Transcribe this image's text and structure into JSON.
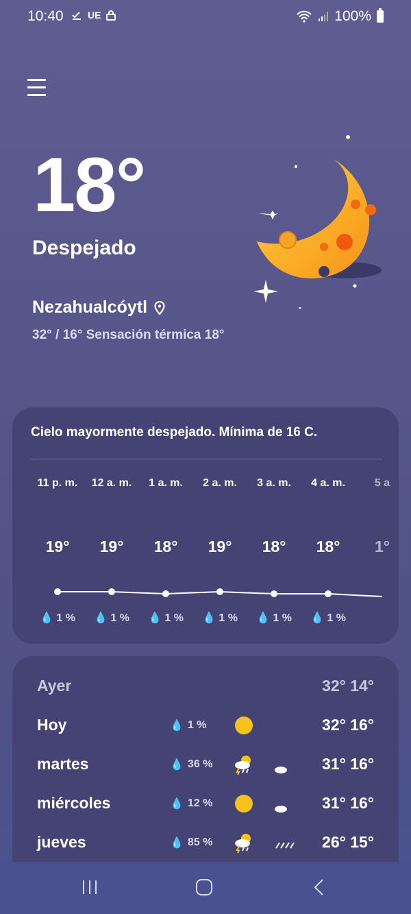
{
  "status_bar": {
    "time": "10:40",
    "notif_label": "UE",
    "battery": "100%"
  },
  "current": {
    "temperature": "18°",
    "condition": "Despejado",
    "location": "Nezahualcóytl",
    "range": "32° / 16° Sensación térmica 18°"
  },
  "hourly": {
    "summary": "Cielo mayormente despejado. Mínima de 16 C.",
    "items": [
      {
        "label": "11 p. m.",
        "temp": "19°",
        "precip": "1 %",
        "icon": "crescent-moon-icon"
      },
      {
        "label": "12 a. m.",
        "temp": "19°",
        "precip": "1 %",
        "icon": "crescent-moon-icon"
      },
      {
        "label": "1 a. m.",
        "temp": "18°",
        "precip": "1 %",
        "icon": "crescent-moon-icon"
      },
      {
        "label": "2 a. m.",
        "temp": "19°",
        "precip": "1 %",
        "icon": "crescent-moon-icon"
      },
      {
        "label": "3 a. m.",
        "temp": "18°",
        "precip": "1 %",
        "icon": "crescent-moon-icon"
      },
      {
        "label": "4 a. m.",
        "temp": "18°",
        "precip": "1 %",
        "icon": "crescent-moon-icon"
      },
      {
        "label": "5 a",
        "temp": "1°",
        "precip": "",
        "icon": "crescent-moon-icon"
      }
    ]
  },
  "daily": [
    {
      "day": "Ayer",
      "precip": "",
      "day_icon": "",
      "night_icon": "",
      "temps": "32° 14°"
    },
    {
      "day": "Hoy",
      "precip": "1 %",
      "day_icon": "sun-icon",
      "night_icon": "crescent-moon-icon",
      "temps": "32° 16°"
    },
    {
      "day": "martes",
      "precip": "36 %",
      "day_icon": "thunderstorm-icon",
      "night_icon": "partly-cloudy-night-icon",
      "temps": "31° 16°"
    },
    {
      "day": "miércoles",
      "precip": "12 %",
      "day_icon": "sun-icon",
      "night_icon": "partly-cloudy-night-icon",
      "temps": "31° 16°"
    },
    {
      "day": "jueves",
      "precip": "85 %",
      "day_icon": "thunderstorm-icon",
      "night_icon": "rain-icon",
      "temps": "26° 15°"
    }
  ],
  "colors": {
    "accent_moon": "#f7c21e",
    "card_bg": "#444374",
    "background": "#56568a"
  }
}
